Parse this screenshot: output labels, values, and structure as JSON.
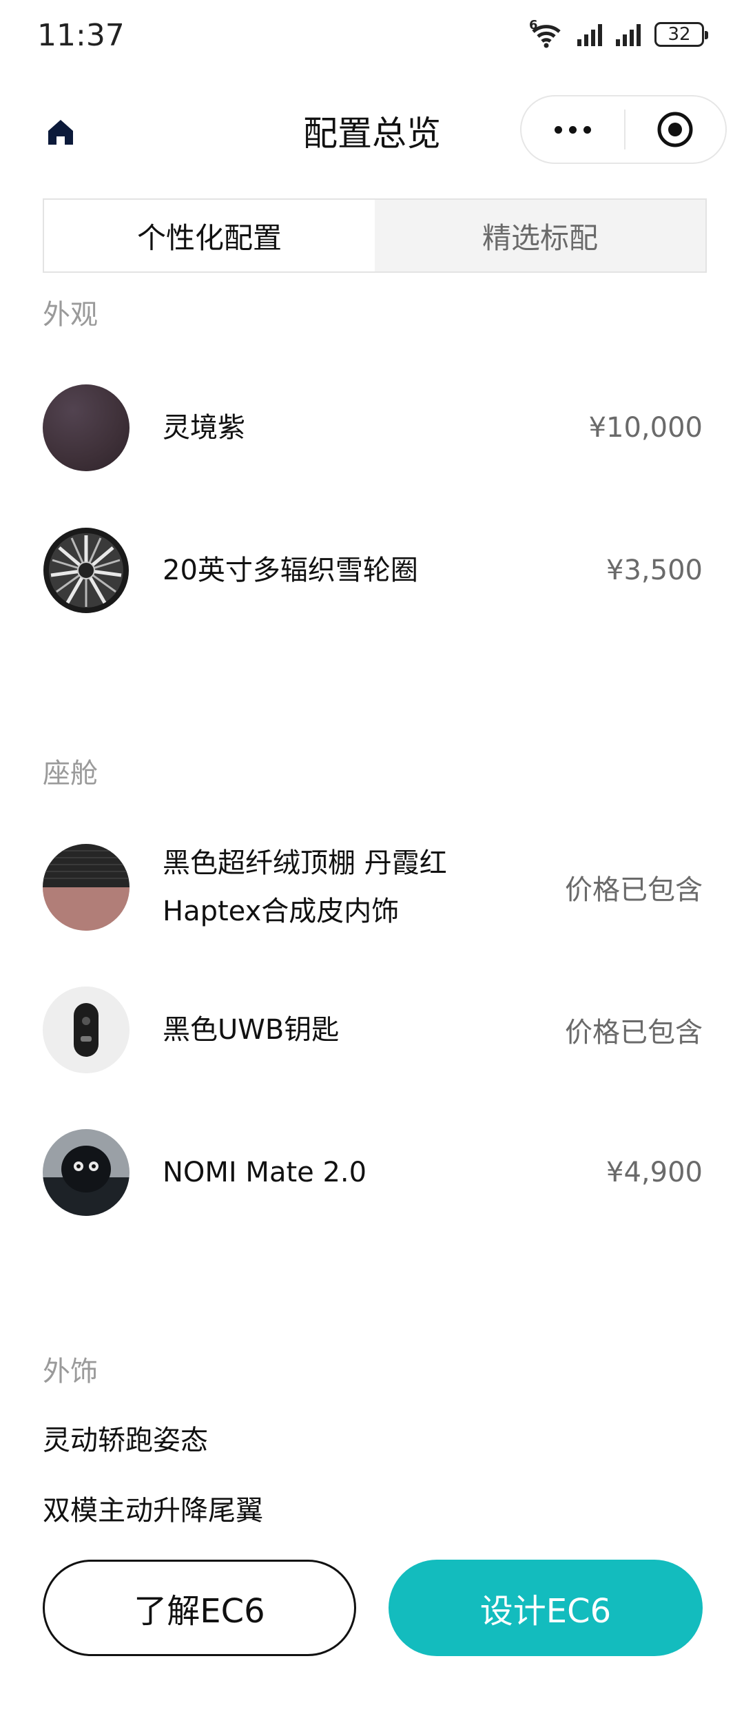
{
  "status_bar": {
    "time": "11:37",
    "wifi_badge": "6",
    "battery": "32",
    "icons": [
      "wifi-icon",
      "signal-icon",
      "signal-icon",
      "battery-icon"
    ]
  },
  "header": {
    "title": "配置总览",
    "home_icon": "home-icon",
    "more_icon": "more-dots-icon",
    "close_icon": "target-close-icon"
  },
  "tabs": [
    {
      "label": "个性化配置",
      "active": true
    },
    {
      "label": "精选标配",
      "active": false
    }
  ],
  "exterior": {
    "label": "外观",
    "items": [
      {
        "name": "灵境紫",
        "price": "¥10,000",
        "thumb": "paint-swatch-purple"
      },
      {
        "name": "20英寸多辐织雪轮圈",
        "price": "¥3,500",
        "thumb": "wheel-rim"
      }
    ]
  },
  "cabin": {
    "label": "座舱",
    "items": [
      {
        "name_line1": "黑色超纤绒顶棚 丹霞红",
        "name_line2": "Haptex合成皮内饰",
        "price": "价格已包含",
        "thumb": "interior-swatch"
      },
      {
        "name": "黑色UWB钥匙",
        "price": "价格已包含",
        "thumb": "uwb-key"
      },
      {
        "name": "NOMI Mate 2.0",
        "price": "¥4,900",
        "thumb": "nomi-robot"
      }
    ]
  },
  "accessories": {
    "label": "外饰",
    "items": [
      "灵动轿跑姿态",
      "双模主动升降尾翼"
    ]
  },
  "buttons": {
    "learn": "了解EC6",
    "design": "设计EC6"
  },
  "colors": {
    "accent": "#13bcbe",
    "muted_text": "#9a9a9a",
    "price_text": "#6a6a6a",
    "paint_purple": "#3e3038"
  }
}
